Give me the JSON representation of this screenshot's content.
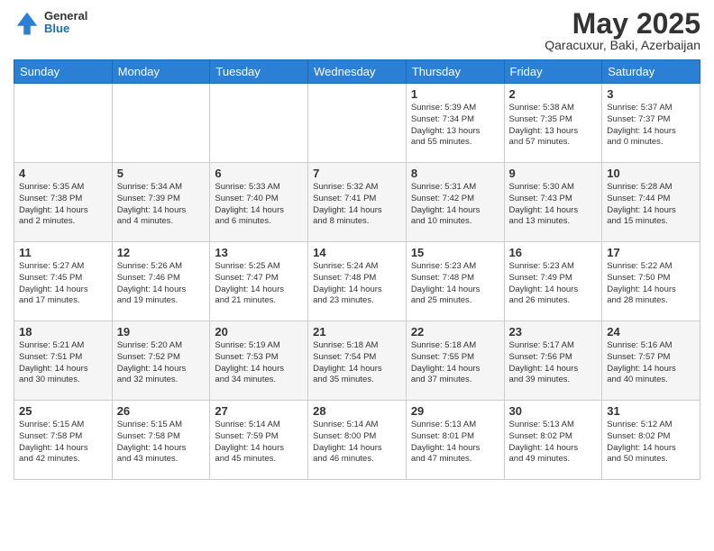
{
  "header": {
    "logo_general": "General",
    "logo_blue": "Blue",
    "month_title": "May 2025",
    "location": "Qaracuxur, Baki, Azerbaijan"
  },
  "days_of_week": [
    "Sunday",
    "Monday",
    "Tuesday",
    "Wednesday",
    "Thursday",
    "Friday",
    "Saturday"
  ],
  "weeks": [
    [
      {
        "day": "",
        "info": ""
      },
      {
        "day": "",
        "info": ""
      },
      {
        "day": "",
        "info": ""
      },
      {
        "day": "",
        "info": ""
      },
      {
        "day": "1",
        "info": "Sunrise: 5:39 AM\nSunset: 7:34 PM\nDaylight: 13 hours\nand 55 minutes."
      },
      {
        "day": "2",
        "info": "Sunrise: 5:38 AM\nSunset: 7:35 PM\nDaylight: 13 hours\nand 57 minutes."
      },
      {
        "day": "3",
        "info": "Sunrise: 5:37 AM\nSunset: 7:37 PM\nDaylight: 14 hours\nand 0 minutes."
      }
    ],
    [
      {
        "day": "4",
        "info": "Sunrise: 5:35 AM\nSunset: 7:38 PM\nDaylight: 14 hours\nand 2 minutes."
      },
      {
        "day": "5",
        "info": "Sunrise: 5:34 AM\nSunset: 7:39 PM\nDaylight: 14 hours\nand 4 minutes."
      },
      {
        "day": "6",
        "info": "Sunrise: 5:33 AM\nSunset: 7:40 PM\nDaylight: 14 hours\nand 6 minutes."
      },
      {
        "day": "7",
        "info": "Sunrise: 5:32 AM\nSunset: 7:41 PM\nDaylight: 14 hours\nand 8 minutes."
      },
      {
        "day": "8",
        "info": "Sunrise: 5:31 AM\nSunset: 7:42 PM\nDaylight: 14 hours\nand 10 minutes."
      },
      {
        "day": "9",
        "info": "Sunrise: 5:30 AM\nSunset: 7:43 PM\nDaylight: 14 hours\nand 13 minutes."
      },
      {
        "day": "10",
        "info": "Sunrise: 5:28 AM\nSunset: 7:44 PM\nDaylight: 14 hours\nand 15 minutes."
      }
    ],
    [
      {
        "day": "11",
        "info": "Sunrise: 5:27 AM\nSunset: 7:45 PM\nDaylight: 14 hours\nand 17 minutes."
      },
      {
        "day": "12",
        "info": "Sunrise: 5:26 AM\nSunset: 7:46 PM\nDaylight: 14 hours\nand 19 minutes."
      },
      {
        "day": "13",
        "info": "Sunrise: 5:25 AM\nSunset: 7:47 PM\nDaylight: 14 hours\nand 21 minutes."
      },
      {
        "day": "14",
        "info": "Sunrise: 5:24 AM\nSunset: 7:48 PM\nDaylight: 14 hours\nand 23 minutes."
      },
      {
        "day": "15",
        "info": "Sunrise: 5:23 AM\nSunset: 7:48 PM\nDaylight: 14 hours\nand 25 minutes."
      },
      {
        "day": "16",
        "info": "Sunrise: 5:23 AM\nSunset: 7:49 PM\nDaylight: 14 hours\nand 26 minutes."
      },
      {
        "day": "17",
        "info": "Sunrise: 5:22 AM\nSunset: 7:50 PM\nDaylight: 14 hours\nand 28 minutes."
      }
    ],
    [
      {
        "day": "18",
        "info": "Sunrise: 5:21 AM\nSunset: 7:51 PM\nDaylight: 14 hours\nand 30 minutes."
      },
      {
        "day": "19",
        "info": "Sunrise: 5:20 AM\nSunset: 7:52 PM\nDaylight: 14 hours\nand 32 minutes."
      },
      {
        "day": "20",
        "info": "Sunrise: 5:19 AM\nSunset: 7:53 PM\nDaylight: 14 hours\nand 34 minutes."
      },
      {
        "day": "21",
        "info": "Sunrise: 5:18 AM\nSunset: 7:54 PM\nDaylight: 14 hours\nand 35 minutes."
      },
      {
        "day": "22",
        "info": "Sunrise: 5:18 AM\nSunset: 7:55 PM\nDaylight: 14 hours\nand 37 minutes."
      },
      {
        "day": "23",
        "info": "Sunrise: 5:17 AM\nSunset: 7:56 PM\nDaylight: 14 hours\nand 39 minutes."
      },
      {
        "day": "24",
        "info": "Sunrise: 5:16 AM\nSunset: 7:57 PM\nDaylight: 14 hours\nand 40 minutes."
      }
    ],
    [
      {
        "day": "25",
        "info": "Sunrise: 5:15 AM\nSunset: 7:58 PM\nDaylight: 14 hours\nand 42 minutes."
      },
      {
        "day": "26",
        "info": "Sunrise: 5:15 AM\nSunset: 7:58 PM\nDaylight: 14 hours\nand 43 minutes."
      },
      {
        "day": "27",
        "info": "Sunrise: 5:14 AM\nSunset: 7:59 PM\nDaylight: 14 hours\nand 45 minutes."
      },
      {
        "day": "28",
        "info": "Sunrise: 5:14 AM\nSunset: 8:00 PM\nDaylight: 14 hours\nand 46 minutes."
      },
      {
        "day": "29",
        "info": "Sunrise: 5:13 AM\nSunset: 8:01 PM\nDaylight: 14 hours\nand 47 minutes."
      },
      {
        "day": "30",
        "info": "Sunrise: 5:13 AM\nSunset: 8:02 PM\nDaylight: 14 hours\nand 49 minutes."
      },
      {
        "day": "31",
        "info": "Sunrise: 5:12 AM\nSunset: 8:02 PM\nDaylight: 14 hours\nand 50 minutes."
      }
    ]
  ]
}
